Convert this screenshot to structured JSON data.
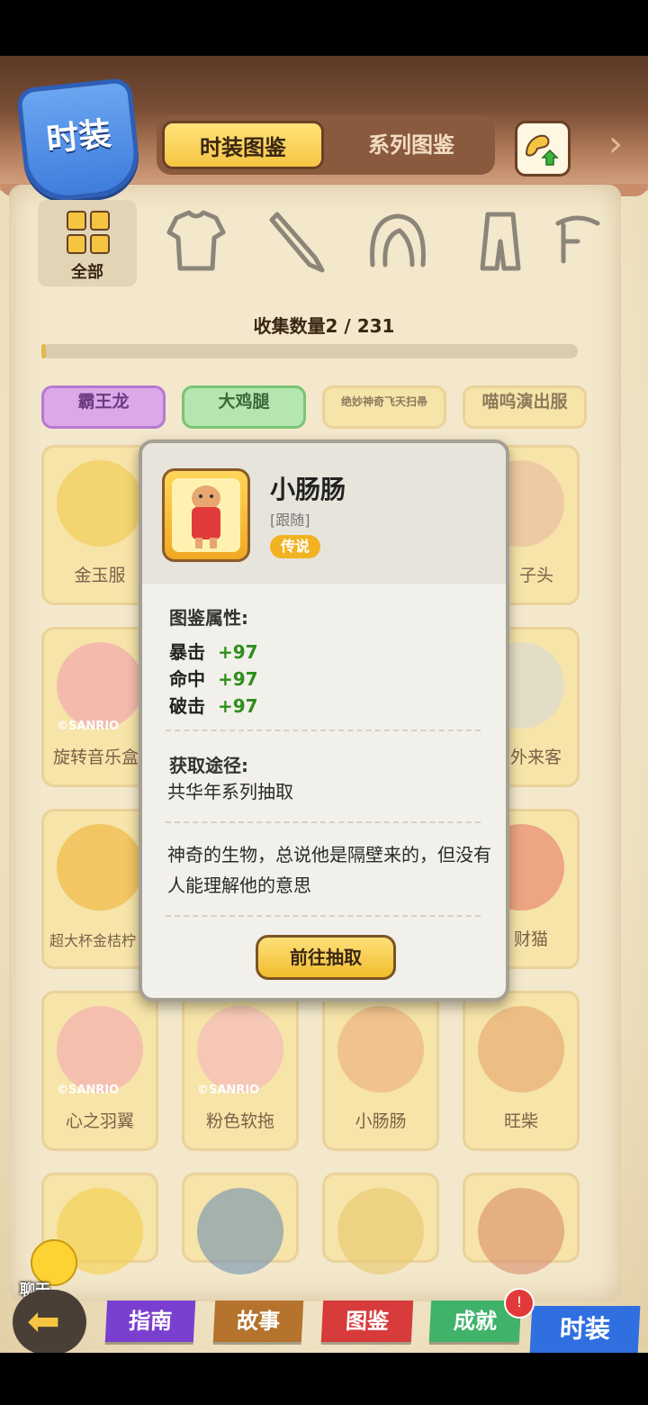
{
  "header": {
    "section_title": "时装",
    "tabs": [
      {
        "label": "时装图鉴",
        "active": true
      },
      {
        "label": "系列图鉴",
        "active": false
      }
    ]
  },
  "categories": {
    "all_label": "全部",
    "icons": [
      "top-clothing-icon",
      "weapon-icon",
      "hair-icon",
      "pants-icon",
      "accessory-icon"
    ]
  },
  "collection": {
    "count_text": "收集数量2 / 231",
    "progress": 0.0087
  },
  "chips": [
    "霸王龙",
    "大鸡腿",
    "绝妙神奇飞天扫帚",
    "喵呜演出服"
  ],
  "cards": [
    [
      "金玉服",
      "",
      "",
      "子头"
    ],
    [
      "旋转音乐盒",
      "",
      "",
      "外来客"
    ],
    [
      "超大杯金桔柠",
      "",
      "",
      "财猫"
    ],
    [
      "心之羽翼",
      "粉色软拖",
      "小肠肠",
      "旺柴"
    ],
    [
      "",
      "",
      "",
      ""
    ]
  ],
  "copyright": "©SANRIO",
  "detail": {
    "name": "小肠肠",
    "type": "[跟随]",
    "rarity": "传说",
    "attr_title": "图鉴属性:",
    "stats": [
      {
        "label": "暴击",
        "value": "+97"
      },
      {
        "label": "命中",
        "value": "+97"
      },
      {
        "label": "破击",
        "value": "+97"
      }
    ],
    "source_title": "获取途径:",
    "source_text": "共华年系列抽取",
    "description": "神奇的生物，总说他是隔壁来的，但没有人能理解他的意思",
    "button": "前往抽取"
  },
  "chat": {
    "label": "聊天"
  },
  "nav": [
    "指南",
    "故事",
    "图鉴",
    "成就",
    "时装"
  ],
  "colors": {
    "nav_guide": "#7b3fd0",
    "nav_story": "#b5732e",
    "nav_codex": "#d83b3b",
    "nav_achieve": "#3fb36a",
    "nav_fashion": "#2f6fe0",
    "stat_value": "#2d8f1b",
    "rarity": "#f2b322"
  }
}
